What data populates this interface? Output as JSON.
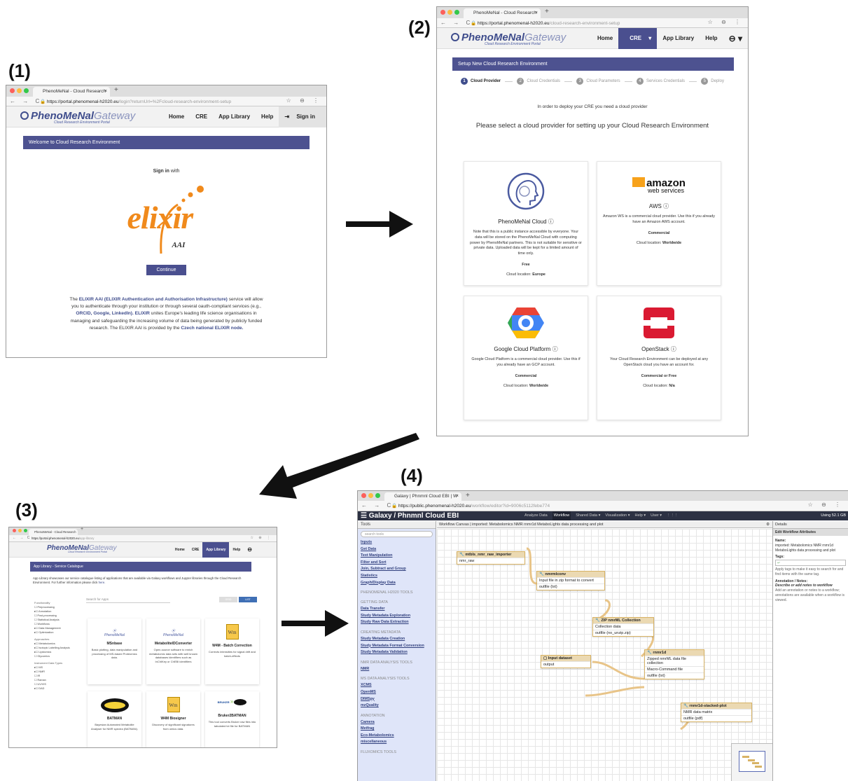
{
  "labels": {
    "p1": "(1)",
    "p2": "(2)",
    "p3": "(3)",
    "p4": "(4)"
  },
  "panel1": {
    "tab_title": "PhenoMeNal - Cloud Research",
    "url_host": "https://portal.phenomenal-h2020.eu",
    "url_path": "/login?returnUrl=%2Fcloud-research-environment-setup",
    "logo_main": "PhenoMeNal",
    "logo_lite": "Gateway",
    "logo_sub": "Cloud Research Environment Portal",
    "nav": [
      "Home",
      "CRE",
      "App Library",
      "Help"
    ],
    "signin": "Sign in",
    "banner": "Welcome to Cloud Research Environment",
    "signin_with_bold": "Sign in",
    "signin_with_rest": "with",
    "elixir_word": "elixir",
    "elixir_aai": "AAI",
    "continue": "Continue",
    "desc_intro": "The",
    "desc_bold1": "ELIXIR AAI (ELIXIR Authentication and Authorisation Infrastructure)",
    "desc_mid1": "service will allow you to authenticate through your institution or through several oauth-compliant services (e.g.,",
    "desc_bold2": "ORCID, Google, LinkedIn).",
    "desc_bold3": "ELIXIR",
    "desc_mid2": "unites Europe's leading life science organisations in managing and safeguarding the increasing volume of data being generated by publicly funded research. The ELIXIR AAI is provided by the",
    "desc_bold4": "Czech national ELIXIR node."
  },
  "panel2": {
    "tab_title": "PhenoMeNal - Cloud Research",
    "url_host": "https://portal.phenomenal-h2020.eu",
    "url_path": "/cloud-research-environment-setup",
    "nav": [
      "Home",
      "CRE",
      "App Library",
      "Help"
    ],
    "banner": "Setup New Cloud Research Environment",
    "steps": [
      "Cloud Provider",
      "Cloud Credentials",
      "Cloud Parameters",
      "Services Credentials",
      "Deploy"
    ],
    "notice": "In order to deploy your CRE you need a cloud provider",
    "heading": "Please select a cloud provider for setting up your Cloud Research Environment",
    "cards": [
      {
        "title": "PhenoMeNal Cloud",
        "desc": "Note that this is a public instance accessible by everyone. Your data will be stored on the PhenoMeNal Cloud with computing power by PhenoMeNal partners. This is not suitable for sensitive or private data. Uploaded data will be kept for a limited amount of time only.",
        "cost": "Free",
        "loc_label": "Cloud location:",
        "loc": "Europe"
      },
      {
        "title": "AWS",
        "desc": "Amazon WS is a commercial cloud provider. Use this if you already have an Amazon AWS account.",
        "cost": "Commercial",
        "loc_label": "Cloud location:",
        "loc": "Worldwide"
      },
      {
        "title": "Google Cloud Platform",
        "desc": "Google Cloud Platform is a commercial cloud provider. Use this if you already have an GCP account.",
        "cost": "Commercial",
        "loc_label": "Cloud location:",
        "loc": "Worldwide"
      },
      {
        "title": "OpenStack",
        "desc": "Your Cloud Research Environment can be deployed at any OpenStack cloud you have an account for.",
        "cost": "Commercial or Free",
        "loc_label": "Cloud location:",
        "loc": "N/a"
      }
    ],
    "amazon_word": "amazon",
    "amazon_sub": "web services"
  },
  "panel3": {
    "tab_title": "PhenoMeNal - Cloud Research",
    "url_host": "https://portal.phenomenal-h2020.eu",
    "url_path": "/app-library",
    "nav": [
      "Home",
      "CRE",
      "App Library",
      "Help"
    ],
    "banner": "App Library - Service Catalogue",
    "intro": "App Library showcases our service catalogue listing of applications that are available via Galaxy workflows and Jupyter libraries through the Cloud Research Environment. For further information please click",
    "intro_link": "here.",
    "search": "Search for Apps",
    "grid_btn": "GRID",
    "list_btn": "LIST",
    "functionality_head": "Functionality",
    "functionality": [
      "Preprocessing",
      "Annotation",
      "Post-processing",
      "Statistical Analysis",
      "Workflows",
      "Data Management",
      "Optimization"
    ],
    "approaches_head": "Approaches",
    "approaches": [
      "Metabolomics",
      "Isotopic Labelling Analysis",
      "Lipidomics",
      "Glycomics"
    ],
    "instrument_head": "Instrument Data Types",
    "instruments": [
      "MS",
      "NMR",
      "IR",
      "Raman",
      "UV/VIS",
      "DAD"
    ],
    "apps": [
      {
        "name": "MSnbase",
        "desc": "Basic plotting, data manipulation and processing of MS-based Proteomics data."
      },
      {
        "name": "MetaboliteIDConverter",
        "desc": "Open-source software to enrich metabolomic data sets with well known databases identifiers such as InChIKey or ChEBI identifiers"
      },
      {
        "name": "W4M - Batch Correction",
        "desc": "Corrects intensities for signal drift and batch-effects"
      },
      {
        "name": "BATMAN",
        "desc": "Bayesian Automated Metabolite Analyser for NMR spectra (BATMAN)."
      },
      {
        "name": "W4M Biosigner",
        "desc": "Discovery of significant signatures from omics data."
      },
      {
        "name": "Bruker2BATMAN",
        "desc": "This tool converts Bruker raw files into tabulated txt file for BATMAN"
      }
    ],
    "logo_pheno": "PhenoMeNal",
    "logo_w4m": "Wm",
    "logo_bruker": "BRUKER"
  },
  "panel4": {
    "tab_title": "Galaxy | Phnmnl Cloud EBI | W",
    "url_host": "https://public.phenomenal-h2020.eu",
    "url_path": "/workflow/editor?id=9006c5112febe774",
    "brand": "Galaxy / Phnmnl Cloud EBI",
    "menu": [
      "Analyze Data",
      "Workflow",
      "Shared Data ▾",
      "Visualization ▾",
      "Help ▾",
      "User ▾",
      "⋮⋮⋮"
    ],
    "using": "Using 52.1 GB",
    "tools_head": "Tools",
    "search_tools": "search tools",
    "tool_links_a": [
      "Inputs",
      "Get Data",
      "Text Manipulation",
      "Filter and Sort",
      "Join, Subtract and Group",
      "Statistics",
      "Graph/Display Data"
    ],
    "sec1": "PHENOMENAL H2020 TOOLS",
    "sec2": "GETTING DATA",
    "tool_links_b": [
      "Data Transfer",
      "Study Metadata Exploration",
      "Study Raw Data Extraction"
    ],
    "sec3": "CREATING METADATA",
    "tool_links_c": [
      "Study Metadata Creation",
      "Study Metadata Format Conversion",
      "Study Metadata Validation"
    ],
    "sec4": "NMR DATA ANALYSIS TOOLS",
    "tool_links_d": [
      "NMR"
    ],
    "sec5": "MS DATA ANALYSIS TOOLS",
    "tool_links_e": [
      "XCMS",
      "OpenMS",
      "DIMSpy",
      "mzQuality"
    ],
    "sec6": "ANNOTATION",
    "tool_links_f": [
      "Camera",
      "Metfrag",
      "Eco-Metabolomics",
      "miscellaneous"
    ],
    "sec7": "FLUXOMICS TOOLS",
    "canvas_title": "Workflow Canvas | imported: Metabolomics NMR rnmr1d MetaboLights data processing and plot",
    "details_head": "Details",
    "details_sub": "Edit Workflow Attributes",
    "name_label": "Name:",
    "name_value": "imported: Metabolomics NMR rnmr1d MetaboLights data processing and plot",
    "tags_label": "Tags:",
    "tags_help": "Apply tags to make it easy to search for and find items with the same tag.",
    "annot_label": "Annotation / Notes:",
    "annot_placeholder": "Describe or add notes to workflow",
    "annot_help": "Add an annotation or notes to a workflow; annotations are available when a workflow is viewed.",
    "nodes": {
      "mtbls": {
        "title": "mtbls_nmr_raw_importer",
        "out": "nmr_raw"
      },
      "nmrmlconv": {
        "title": "nmrmlconv",
        "in": "Input file in zip format to convert",
        "out": "outfile (txt)"
      },
      "zip": {
        "title": "ZIP nmrML Collection",
        "in": "Collection data",
        "out": "outfile (no_unzip.zip)"
      },
      "input": {
        "title": "Input dataset",
        "out": "output"
      },
      "rnmr1d": {
        "title": "rnmr1d",
        "in1": "Zipped nmrML data file collection",
        "in2": "Macro-Command file",
        "out": "outfile (txt)"
      },
      "plot": {
        "title": "rnmr1d-stacked-plot",
        "in": "NMR data matrix",
        "out": "outfile (pdf)"
      }
    }
  }
}
